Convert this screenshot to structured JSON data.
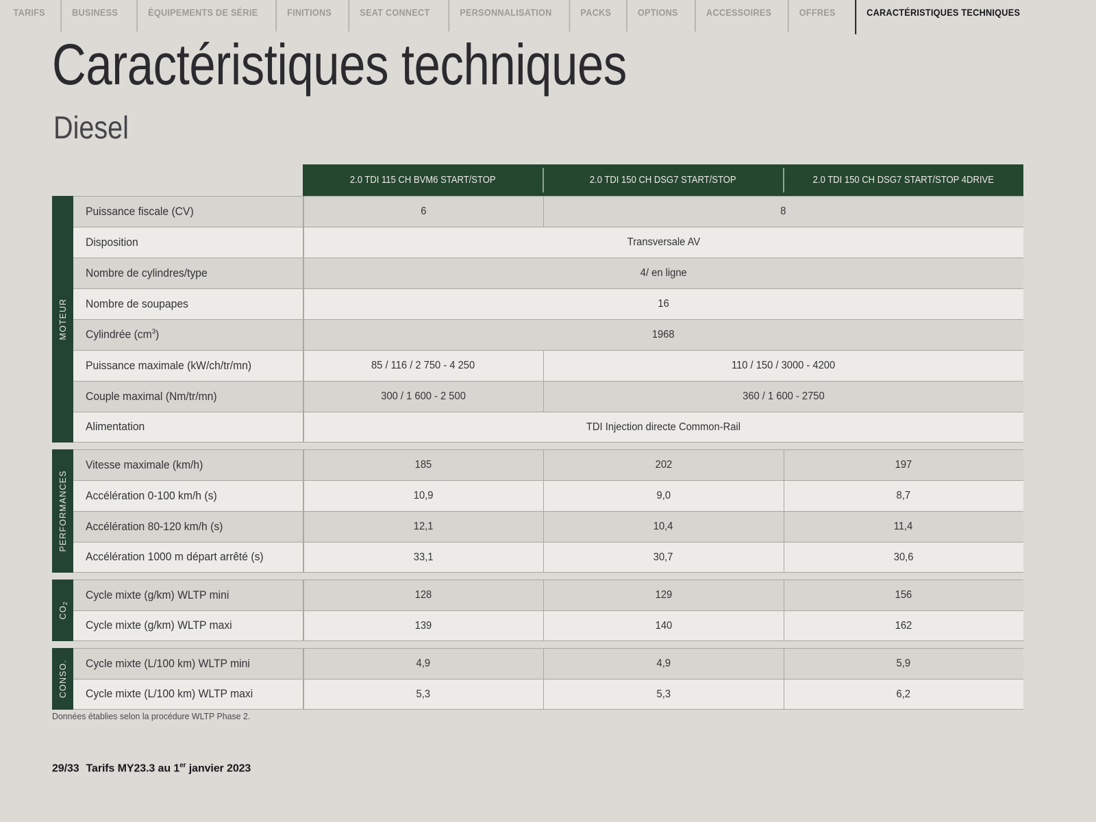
{
  "nav": {
    "items": [
      {
        "label": "TARIFS",
        "active": false
      },
      {
        "label": "BUSINESS",
        "active": false
      },
      {
        "label": "ÉQUIPEMENTS DE SÉRIE",
        "active": false
      },
      {
        "label": "FINITIONS",
        "active": false
      },
      {
        "label": "SEAT CONNECT",
        "active": false
      },
      {
        "label": "PERSONNALISATION",
        "active": false
      },
      {
        "label": "PACKS",
        "active": false
      },
      {
        "label": "OPTIONS",
        "active": false
      },
      {
        "label": "ACCESSOIRES",
        "active": false
      },
      {
        "label": "OFFRES",
        "active": false
      },
      {
        "label": "CARACTÉRISTIQUES TECHNIQUES",
        "active": true
      }
    ]
  },
  "header": {
    "title": "Caractéristiques techniques",
    "subtitle": "Diesel"
  },
  "colors": {
    "page_background": "#dcdad5",
    "accent_green": "#234433",
    "header_green": "#25462f",
    "row_odd": "#d7d5d0",
    "row_even": "#ecebe7",
    "rule": "#a9a7a2",
    "text": "#333236"
  },
  "table": {
    "columns": [
      "2.0 TDI 115 CH BVM6 START/STOP",
      "2.0 TDI 150 CH DSG7 START/STOP",
      "2.0 TDI 150 CH DSG7 START/STOP 4DRIVE"
    ],
    "sections": [
      {
        "name": "MOTEUR",
        "rows": [
          {
            "label": "Puissance fiscale (CV)",
            "cells": [
              {
                "text": "6",
                "span": 1
              },
              {
                "text": "8",
                "span": 2
              }
            ]
          },
          {
            "label": "Disposition",
            "cells": [
              {
                "text": "Transversale AV",
                "span": 3
              }
            ]
          },
          {
            "label": "Nombre de cylindres/type",
            "cells": [
              {
                "text": "4/ en ligne",
                "span": 3
              }
            ]
          },
          {
            "label": "Nombre de soupapes",
            "cells": [
              {
                "text": "16",
                "span": 3
              }
            ]
          },
          {
            "label": "Cylindrée (cm3)",
            "label_sup": "3",
            "label_base": "Cylindrée (cm",
            "label_tail": ")",
            "cells": [
              {
                "text": "1968",
                "span": 3
              }
            ]
          },
          {
            "label": "Puissance maximale (kW/ch/tr/mn)",
            "cells": [
              {
                "text": "85 / 116 / 2 750 - 4 250",
                "span": 1
              },
              {
                "text": "110 / 150 / 3000 - 4200",
                "span": 2
              }
            ]
          },
          {
            "label": "Couple maximal (Nm/tr/mn)",
            "cells": [
              {
                "text": "300 / 1 600 - 2 500",
                "span": 1
              },
              {
                "text": "360 / 1 600 - 2750",
                "span": 2
              }
            ]
          },
          {
            "label": "Alimentation",
            "cells": [
              {
                "text": "TDI Injection directe Common-Rail",
                "span": 3
              }
            ]
          }
        ]
      },
      {
        "name": "PERFORMANCES",
        "rows": [
          {
            "label": "Vitesse maximale (km/h)",
            "cells": [
              {
                "text": "185",
                "span": 1
              },
              {
                "text": "202",
                "span": 1
              },
              {
                "text": "197",
                "span": 1
              }
            ]
          },
          {
            "label": "Accélération 0-100 km/h (s)",
            "cells": [
              {
                "text": "10,9",
                "span": 1
              },
              {
                "text": "9,0",
                "span": 1
              },
              {
                "text": "8,7",
                "span": 1
              }
            ]
          },
          {
            "label": "Accélération 80-120 km/h (s)",
            "cells": [
              {
                "text": "12,1",
                "span": 1
              },
              {
                "text": "10,4",
                "span": 1
              },
              {
                "text": "11,4",
                "span": 1
              }
            ]
          },
          {
            "label": "Accélération 1000 m départ arrêté (s)",
            "cells": [
              {
                "text": "33,1",
                "span": 1
              },
              {
                "text": "30,7",
                "span": 1
              },
              {
                "text": "30,6",
                "span": 1
              }
            ]
          }
        ]
      },
      {
        "name": "CO2",
        "name_base": "CO",
        "name_sub": "2",
        "rows": [
          {
            "label": "Cycle mixte (g/km) WLTP mini",
            "cells": [
              {
                "text": "128",
                "span": 1
              },
              {
                "text": "129",
                "span": 1
              },
              {
                "text": "156",
                "span": 1
              }
            ]
          },
          {
            "label": "Cycle mixte (g/km) WLTP maxi",
            "cells": [
              {
                "text": "139",
                "span": 1
              },
              {
                "text": "140",
                "span": 1
              },
              {
                "text": "162",
                "span": 1
              }
            ]
          }
        ]
      },
      {
        "name": "CONSO.",
        "rows": [
          {
            "label": "Cycle mixte (L/100 km) WLTP mini",
            "cells": [
              {
                "text": "4,9",
                "span": 1
              },
              {
                "text": "4,9",
                "span": 1
              },
              {
                "text": "5,9",
                "span": 1
              }
            ]
          },
          {
            "label": "Cycle mixte (L/100 km) WLTP maxi",
            "cells": [
              {
                "text": "5,3",
                "span": 1
              },
              {
                "text": "5,3",
                "span": 1
              },
              {
                "text": "6,2",
                "span": 1
              }
            ]
          }
        ]
      }
    ]
  },
  "footnote": "Données établies selon la procédure WLTP Phase 2.",
  "footer": {
    "page": "29/33",
    "text_before": "Tarifs MY23.3 au 1",
    "ordinal": "er",
    "text_after": " janvier 2023"
  }
}
